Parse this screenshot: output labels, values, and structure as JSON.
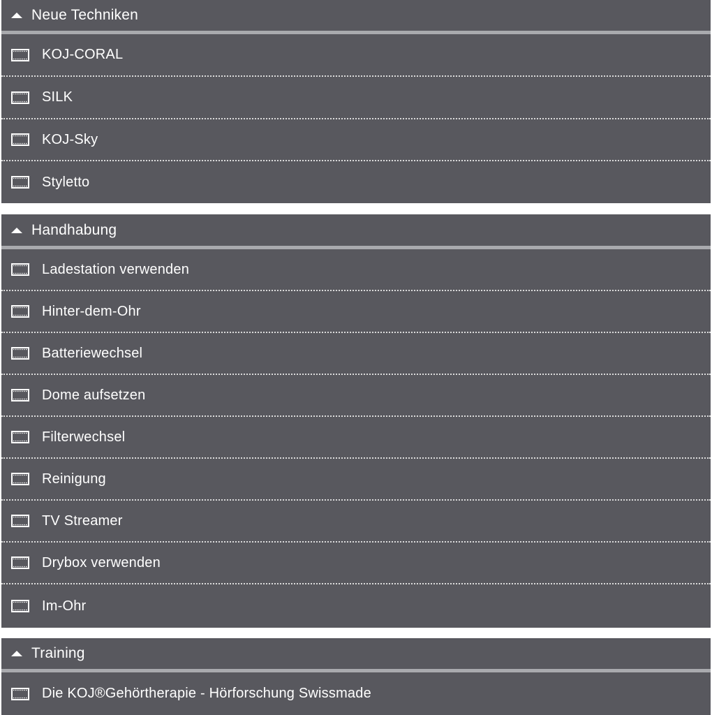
{
  "sections": [
    {
      "title": "Neue Techniken",
      "items": [
        "KOJ-CORAL",
        "SILK",
        "KOJ-Sky",
        "Styletto"
      ]
    },
    {
      "title": "Handhabung",
      "items": [
        "Ladestation verwenden",
        "Hinter-dem-Ohr",
        "Batteriewechsel",
        "Dome aufsetzen",
        "Filterwechsel",
        "Reinigung",
        "TV Streamer",
        "Drybox verwenden",
        "Im-Ohr"
      ]
    },
    {
      "title": "Training",
      "items": [
        "Die KOJ®Gehörtherapie - Hörforschung Swissmade"
      ]
    }
  ],
  "icons": {
    "header": "caret-up-icon",
    "item": "film-icon"
  },
  "colors": {
    "panel": "#58585e",
    "header_rule": "#a9aaae",
    "divider": "#dcdcdc",
    "text": "#ffffff"
  }
}
